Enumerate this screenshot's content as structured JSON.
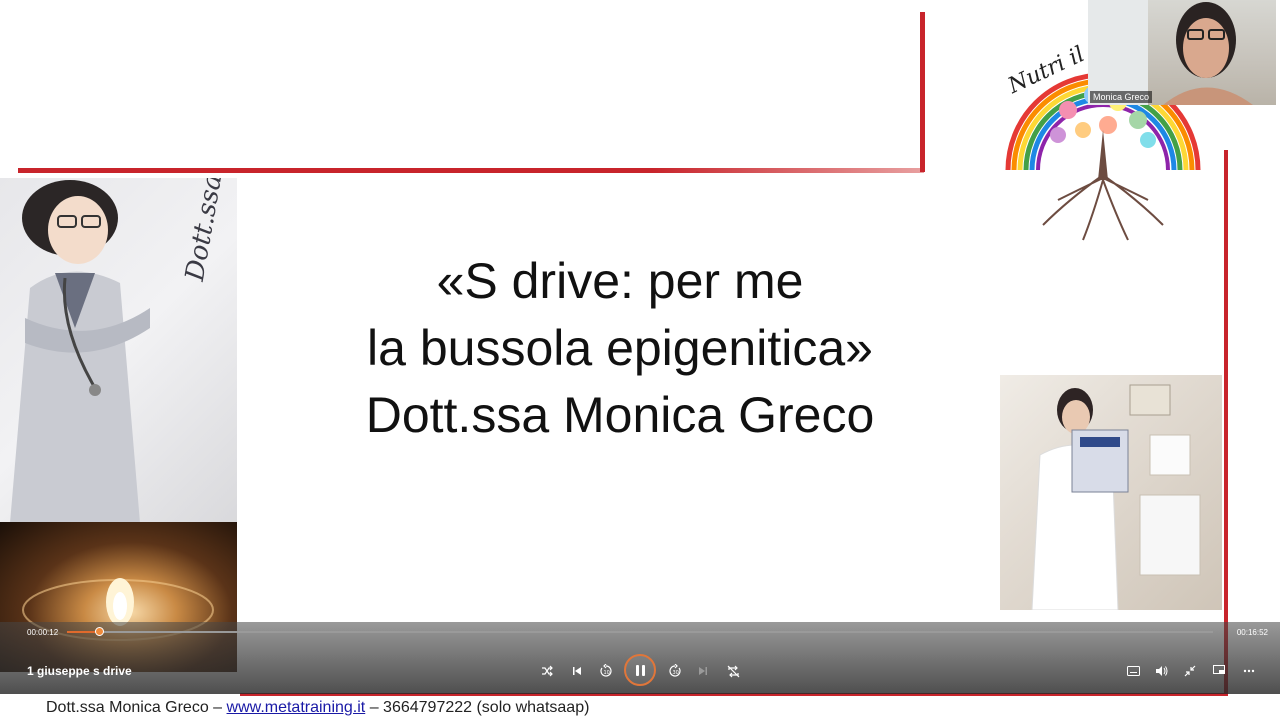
{
  "slide": {
    "title_lines": [
      "«S drive: per me",
      "la bussola epigenitica»",
      "Dott.ssa Monica Greco"
    ],
    "illustration_signature": "Dott.ssa Monica",
    "logo_text": "Nutri il"
  },
  "webcam": {
    "name": "Monica Greco"
  },
  "player": {
    "current_time": "00:00:12",
    "total_time": "00:16:52",
    "progress": 0.012,
    "video_title": "1 giuseppe s drive",
    "controls": [
      "shuffle-icon",
      "previous-icon",
      "rewind-10-icon",
      "pause-icon",
      "forward-30-icon",
      "next-icon",
      "repeat-off-icon"
    ],
    "right_controls": [
      "captions-icon",
      "volume-icon",
      "collapse-icon",
      "miniplayer-icon",
      "more-icon"
    ],
    "accent": "#e06a2c"
  },
  "footer": {
    "name": "Dott.ssa Monica Greco –",
    "link": "www.metatraining.it",
    "contact": "– 3664797222 (solo whatsaap)"
  },
  "colors": {
    "slide_red": "#c8242b",
    "text": "#111111"
  }
}
